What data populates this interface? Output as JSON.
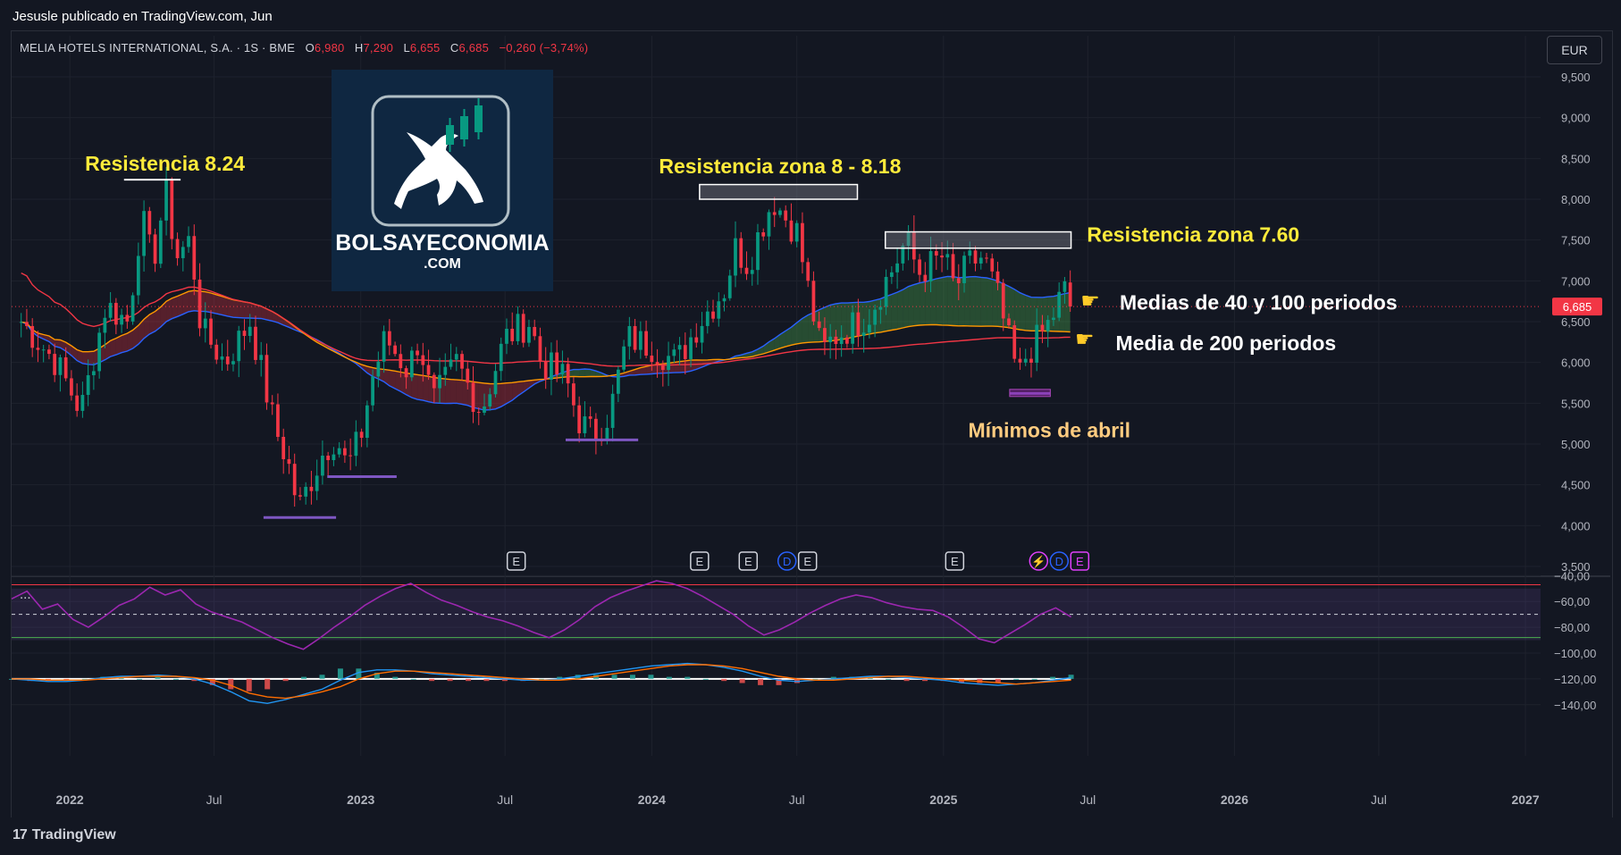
{
  "header": {
    "publisher": "Jesusle publicado en TradingView.com, Jun"
  },
  "legend": {
    "symbol": "MELIA HOTELS INTERNATIONAL, S.A. · 1S · BME",
    "o_label": "O",
    "o_value": "6,980",
    "h_label": "H",
    "h_value": "7,290",
    "l_label": "L",
    "l_value": "6,655",
    "c_label": "C",
    "c_value": "6,685",
    "change": "−0,260 (−3,74%)"
  },
  "currency_button": "EUR",
  "indicator_menu": "...",
  "footer": {
    "brand": "TradingView",
    "brand_icon": "tradingview-logo-icon"
  },
  "logo": {
    "name": "BOLSAYECONOMIA",
    "sub": ".COM",
    "icon": "bull-candlestick-icon",
    "bg": "#0f2741"
  },
  "colors": {
    "background": "#131722",
    "up": "#089981",
    "down": "#f23645",
    "ma40": "#2962ff",
    "ma100": "#ff9800",
    "ma200": "#f23645",
    "rsi": "#9c27b0",
    "macd": "#2196f3",
    "signal": "#ff6d00",
    "annotation_yellow": "#ffeb3b",
    "annotation_orange": "#ffcc80",
    "support_line": "#7e57c2"
  },
  "chart_data": [
    {
      "type": "candlestick",
      "price_axis": [
        "9,500",
        "9,000",
        "8,500",
        "8,000",
        "7,500",
        "7,000",
        "6,500",
        "6,000",
        "5,500",
        "5,000",
        "4,500",
        "4,000",
        "3,500"
      ],
      "ylim": [
        3.5,
        9.5
      ],
      "last_price_label": "6,685",
      "last_price": 6.685,
      "time_axis": [
        "2022",
        "Jul",
        "2023",
        "Jul",
        "2024",
        "Jul",
        "2025",
        "Jul",
        "2026",
        "Jul",
        "2027"
      ],
      "price_path": [
        [
          "2021-11-01",
          6.5
        ],
        [
          "2021-12-15",
          6.0
        ],
        [
          "2022-01-15",
          5.4
        ],
        [
          "2022-02-15",
          6.7
        ],
        [
          "2022-03-15",
          6.5
        ],
        [
          "2022-04-01",
          7.8
        ],
        [
          "2022-04-15",
          7.2
        ],
        [
          "2022-05-01",
          8.1
        ],
        [
          "2022-05-15",
          7.3
        ],
        [
          "2022-06-01",
          7.5
        ],
        [
          "2022-06-15",
          6.4
        ],
        [
          "2022-07-15",
          6.0
        ],
        [
          "2022-08-15",
          6.5
        ],
        [
          "2022-09-15",
          5.2
        ],
        [
          "2022-10-01",
          4.8
        ],
        [
          "2022-10-15",
          4.2
        ],
        [
          "2022-11-01",
          4.6
        ],
        [
          "2022-11-15",
          4.9
        ],
        [
          "2022-12-01",
          5.1
        ],
        [
          "2022-12-15",
          4.7
        ],
        [
          "2023-01-01",
          5.1
        ],
        [
          "2023-01-15",
          5.8
        ],
        [
          "2023-02-01",
          6.3
        ],
        [
          "2023-03-01",
          5.9
        ],
        [
          "2023-03-15",
          6.3
        ],
        [
          "2023-04-01",
          5.5
        ],
        [
          "2023-05-01",
          6.0
        ],
        [
          "2023-06-01",
          5.4
        ],
        [
          "2023-07-01",
          6.3
        ],
        [
          "2023-08-01",
          6.5
        ],
        [
          "2023-08-15",
          6.0
        ],
        [
          "2023-09-15",
          5.8
        ],
        [
          "2023-10-01",
          5.3
        ],
        [
          "2023-10-20",
          5.1
        ],
        [
          "2023-11-10",
          5.4
        ],
        [
          "2023-12-01",
          6.3
        ],
        [
          "2024-01-01",
          6.2
        ],
        [
          "2024-02-01",
          6.0
        ],
        [
          "2024-03-01",
          6.5
        ],
        [
          "2024-04-01",
          6.9
        ],
        [
          "2024-04-15",
          7.4
        ],
        [
          "2024-05-01",
          7.2
        ],
        [
          "2024-05-15",
          7.6
        ],
        [
          "2024-06-01",
          8.0
        ],
        [
          "2024-06-15",
          7.8
        ],
        [
          "2024-07-01",
          7.6
        ],
        [
          "2024-07-15",
          6.9
        ],
        [
          "2024-08-01",
          6.1
        ],
        [
          "2024-08-15",
          6.3
        ],
        [
          "2024-09-01",
          6.4
        ],
        [
          "2024-10-01",
          6.6
        ],
        [
          "2024-10-15",
          6.9
        ],
        [
          "2024-11-01",
          7.2
        ],
        [
          "2024-11-15",
          7.5
        ],
        [
          "2024-12-01",
          7.1
        ],
        [
          "2025-01-01",
          7.3
        ],
        [
          "2025-01-15",
          6.9
        ],
        [
          "2025-02-01",
          7.2
        ],
        [
          "2025-02-20",
          7.3
        ],
        [
          "2025-03-10",
          6.8
        ],
        [
          "2025-03-20",
          6.4
        ],
        [
          "2025-04-05",
          5.8
        ],
        [
          "2025-04-15",
          6.1
        ],
        [
          "2025-05-01",
          6.3
        ],
        [
          "2025-05-15",
          6.5
        ],
        [
          "2025-06-01",
          6.9
        ],
        [
          "2025-06-10",
          6.685
        ]
      ],
      "moving_averages": [
        {
          "name": "Medias de 40 y 100 periodos",
          "periods": [
            40,
            100
          ]
        },
        {
          "name": "Media de 200 periodos",
          "periods": [
            200
          ]
        }
      ],
      "annotations": [
        {
          "text": "Resistencia 8.24",
          "color": "#ffeb3b"
        },
        {
          "text": "Resistencia zona 8 - 8.18",
          "color": "#ffeb3b"
        },
        {
          "text": "Resistencia zona 7.60",
          "color": "#ffeb3b"
        },
        {
          "text": "Medias de 40 y 100 periodos",
          "color": "#ffffff"
        },
        {
          "text": "Media de 200 periodos",
          "color": "#ffffff"
        },
        {
          "text": "Mínimos de abril",
          "color": "#ffcc80"
        }
      ],
      "resistance_zones": [
        {
          "from": 8.0,
          "to": 8.18,
          "start": "2024-03-01",
          "end": "2024-09-15"
        },
        {
          "from": 7.4,
          "to": 7.6,
          "start": "2024-10-20",
          "end": "2025-06-10"
        }
      ],
      "support_marks": [
        {
          "level": 4.1,
          "start": "2022-09-01",
          "end": "2022-12-01"
        },
        {
          "level": 4.6,
          "start": "2022-11-20",
          "end": "2023-02-15"
        },
        {
          "level": 5.05,
          "start": "2023-09-15",
          "end": "2023-12-15"
        },
        {
          "level": 5.62,
          "start": "2025-03-25",
          "end": "2025-05-15"
        }
      ],
      "event_markers": [
        {
          "date": "2023-07-15",
          "labels": [
            "E"
          ]
        },
        {
          "date": "2024-03-01",
          "labels": [
            "E"
          ]
        },
        {
          "date": "2024-05-01",
          "labels": [
            "E"
          ]
        },
        {
          "date": "2024-07-01",
          "labels": [
            "D",
            "E"
          ]
        },
        {
          "date": "2025-01-15",
          "labels": [
            "E"
          ]
        },
        {
          "date": "2025-05-25",
          "labels": [
            "⚡",
            "D",
            "E"
          ]
        }
      ]
    },
    {
      "type": "line",
      "name": "RSI",
      "axis": [
        "−40,00",
        "−60,00",
        "−80,00",
        "−100,00",
        "−120,00",
        "−140,00"
      ],
      "ylim": [
        -145,
        -37
      ],
      "band": [
        -90,
        -50
      ],
      "midline": -70,
      "values": [
        -58,
        -52,
        -66,
        -62,
        -74,
        -80,
        -72,
        -63,
        -58,
        -49,
        -55,
        -51,
        -62,
        -68,
        -72,
        -76,
        -82,
        -88,
        -93,
        -97,
        -89,
        -80,
        -72,
        -63,
        -56,
        -50,
        -46,
        -53,
        -59,
        -63,
        -68,
        -72,
        -75,
        -79,
        -84,
        -88,
        -82,
        -74,
        -64,
        -57,
        -52,
        -48,
        -44,
        -46,
        -50,
        -56,
        -63,
        -70,
        -79,
        -86,
        -82,
        -76,
        -69,
        -63,
        -58,
        -55,
        -57,
        -61,
        -64,
        -66,
        -67,
        -72,
        -80,
        -89,
        -92,
        -85,
        -78,
        -70,
        -65,
        -72
      ]
    },
    {
      "type": "line",
      "name": "MACD",
      "series": [
        {
          "name": "macd",
          "values": [
            -120,
            -121,
            -122,
            -122,
            -121,
            -119,
            -118,
            -118,
            -117,
            -118,
            -120,
            -124,
            -130,
            -137,
            -139,
            -136,
            -132,
            -128,
            -121,
            -115,
            -113,
            -113,
            -114,
            -116,
            -117,
            -118,
            -119,
            -120,
            -121,
            -121,
            -120,
            -118,
            -116,
            -114,
            -112,
            -110,
            -109,
            -108,
            -109,
            -111,
            -114,
            -118,
            -121,
            -122,
            -121,
            -120,
            -119,
            -118,
            -118,
            -119,
            -120,
            -121,
            -123,
            -124,
            -125,
            -124,
            -123,
            -121,
            -119
          ]
        },
        {
          "name": "signal",
          "values": [
            -120,
            -120,
            -121,
            -121,
            -121,
            -120,
            -119,
            -118,
            -118,
            -118,
            -119,
            -121,
            -125,
            -131,
            -134,
            -135,
            -133,
            -130,
            -126,
            -120,
            -116,
            -114,
            -114,
            -115,
            -116,
            -117,
            -118,
            -119,
            -120,
            -121,
            -121,
            -120,
            -118,
            -116,
            -114,
            -112,
            -110,
            -109,
            -109,
            -110,
            -112,
            -115,
            -118,
            -120,
            -121,
            -121,
            -120,
            -119,
            -118,
            -118,
            -119,
            -120,
            -121,
            -122,
            -123,
            -124,
            -123,
            -122,
            -121
          ]
        }
      ]
    }
  ]
}
